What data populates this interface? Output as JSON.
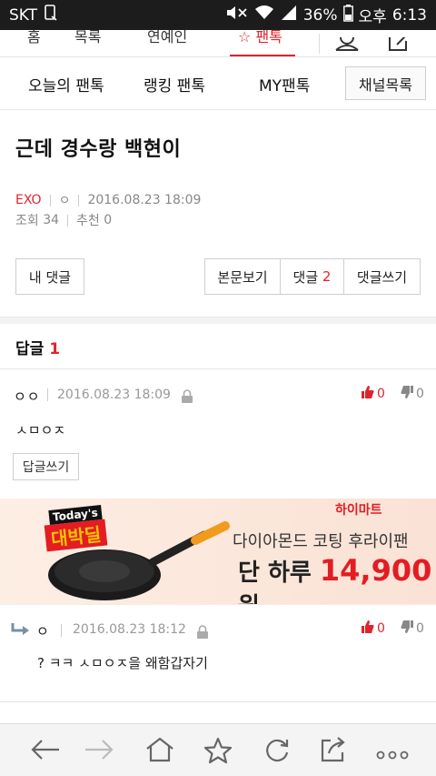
{
  "status_bar": {
    "carrier": "SKT",
    "battery": "36%",
    "ampm": "오후",
    "time": "6:13"
  },
  "top_tabs": {
    "items": [
      "홈",
      "목록",
      "연예인",
      "팬톡"
    ],
    "active_index": 3
  },
  "sub_nav": {
    "items": [
      "오늘의 팬톡",
      "랭킹 팬톡",
      "MY팬톡"
    ],
    "channel_button": "채널목록"
  },
  "post": {
    "title": "근데 경수랑 백현이",
    "channel": "EXO",
    "author": "ㅇ",
    "datetime": "2016.08.23 18:09",
    "views_label": "조회",
    "views": "34",
    "likes_label": "추천",
    "likes": "0"
  },
  "actions": {
    "my_comments": "내 댓글",
    "view_post": "본문보기",
    "comments_label": "댓글",
    "comments_count": "2",
    "write_comment": "댓글쓰기"
  },
  "replies": {
    "label": "답글",
    "count": "1"
  },
  "comments": [
    {
      "author": "ㅇㅇ",
      "datetime": "2016.08.23 18:09",
      "up": "0",
      "down": "0",
      "body": "ㅅㅁㅇㅈ",
      "reply_button": "답글쓰기"
    },
    {
      "author": "ㅇ",
      "datetime": "2016.08.23 18:12",
      "up": "0",
      "down": "0",
      "body": "? ㅋㅋ ㅅㅁㅇㅈ을 왜함갑자기"
    }
  ],
  "ad": {
    "badge_top": "Today's",
    "badge_main": "대박딜",
    "brand": "하이마트",
    "line1": "다이아몬드 코팅 후라이팬",
    "line2_prefix": "단 하루",
    "price": "14,900",
    "unit": "원"
  },
  "colors": {
    "accent": "#e0242b",
    "text": "#222222",
    "muted": "#999999"
  },
  "icons": {
    "bottom_bar": [
      "back-arrow-icon",
      "forward-arrow-icon",
      "home-icon",
      "star-icon",
      "refresh-icon",
      "share-icon",
      "more-icon"
    ]
  }
}
